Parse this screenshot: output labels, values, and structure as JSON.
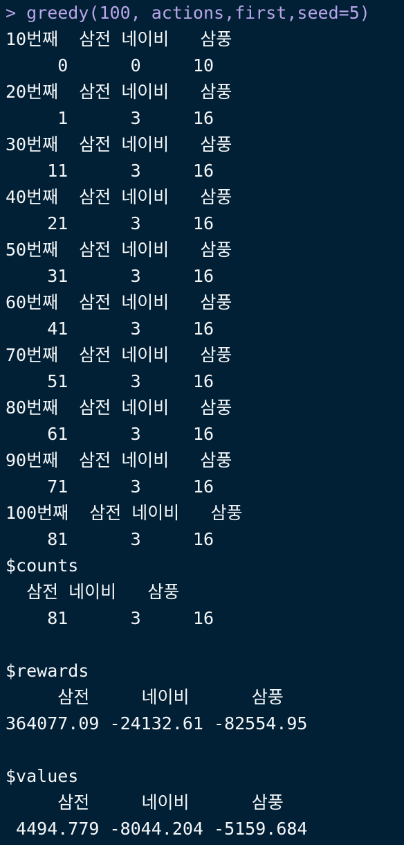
{
  "console": {
    "theme": {
      "background": "#012035",
      "output_color": "#f5f7f9",
      "command_color": "#b9a5e9"
    },
    "lines": [
      {
        "kind": "cmd",
        "text": "> greedy(100, actions,first,seed=5)"
      },
      {
        "kind": "out",
        "text": "10번째  삼전 네이비   삼풍"
      },
      {
        "kind": "out",
        "text": "     0      0     10"
      },
      {
        "kind": "out",
        "text": "20번째  삼전 네이비   삼풍"
      },
      {
        "kind": "out",
        "text": "     1      3     16"
      },
      {
        "kind": "out",
        "text": "30번째  삼전 네이비   삼풍"
      },
      {
        "kind": "out",
        "text": "    11      3     16"
      },
      {
        "kind": "out",
        "text": "40번째  삼전 네이비   삼풍"
      },
      {
        "kind": "out",
        "text": "    21      3     16"
      },
      {
        "kind": "out",
        "text": "50번째  삼전 네이비   삼풍"
      },
      {
        "kind": "out",
        "text": "    31      3     16"
      },
      {
        "kind": "out",
        "text": "60번째  삼전 네이비   삼풍"
      },
      {
        "kind": "out",
        "text": "    41      3     16"
      },
      {
        "kind": "out",
        "text": "70번째  삼전 네이비   삼풍"
      },
      {
        "kind": "out",
        "text": "    51      3     16"
      },
      {
        "kind": "out",
        "text": "80번째  삼전 네이비   삼풍"
      },
      {
        "kind": "out",
        "text": "    61      3     16"
      },
      {
        "kind": "out",
        "text": "90번째  삼전 네이비   삼풍"
      },
      {
        "kind": "out",
        "text": "    71      3     16"
      },
      {
        "kind": "out",
        "text": "100번째  삼전 네이비   삼풍"
      },
      {
        "kind": "out",
        "text": "    81      3     16"
      },
      {
        "kind": "out",
        "text": "$counts"
      },
      {
        "kind": "out",
        "text": "  삼전 네이비   삼풍"
      },
      {
        "kind": "out",
        "text": "    81      3     16"
      },
      {
        "kind": "blank",
        "text": ""
      },
      {
        "kind": "out",
        "text": "$rewards"
      },
      {
        "kind": "out",
        "text": "     삼전     네이비      삼풍"
      },
      {
        "kind": "out",
        "text": "364077.09 -24132.61 -82554.95"
      },
      {
        "kind": "blank",
        "text": ""
      },
      {
        "kind": "out",
        "text": "$values"
      },
      {
        "kind": "out",
        "text": "     삼전     네이비      삼풍"
      },
      {
        "kind": "out",
        "text": " 4494.779 -8044.204 -5159.684"
      }
    ]
  }
}
